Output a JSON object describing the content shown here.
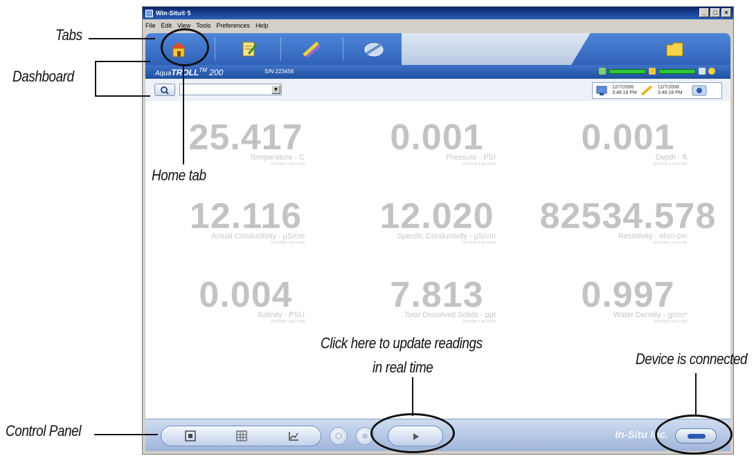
{
  "window": {
    "title": "Win-Situ® 5",
    "controls": [
      "_",
      "□",
      "×"
    ]
  },
  "menu": [
    "File",
    "Edit",
    "View",
    "Tools",
    "Preferences",
    "Help"
  ],
  "tabs": [
    {
      "icon": "home-icon"
    },
    {
      "icon": "sites-notepad-icon"
    },
    {
      "icon": "calibration-icon"
    },
    {
      "icon": "logging-icon"
    },
    {
      "icon": "folder-icon"
    }
  ],
  "dashboard": {
    "device_name_prefix": "Aqua",
    "device_name": "TROLL",
    "device_tm": "TM",
    "device_model": "200",
    "serial": "S/N 223456",
    "pc_time": {
      "date": "12/7/2006",
      "time": "3:48:18 PM"
    },
    "device_time": {
      "date": "12/7/2006",
      "time": "3:48:18 PM"
    }
  },
  "readings": [
    {
      "value": "25.417",
      "label": "Temperature - C",
      "timestamp": "12/7/2006 3:48:14 PM"
    },
    {
      "value": "0.001",
      "label": "Pressure - PSI",
      "timestamp": "12/7/2006 3:48:14 PM"
    },
    {
      "value": "0.001",
      "label": "Depth - ft",
      "timestamp": "12/7/2006 3:48:14 PM"
    },
    {
      "value": "12.116",
      "label": "Actual Conductivity - µS/cm",
      "timestamp": "12/7/2006 3:48:14 PM"
    },
    {
      "value": "12.020",
      "label": "Specific Conductivity - µS/cm",
      "timestamp": "12/7/2006 3:48:14 PM"
    },
    {
      "value": "82534.578",
      "label": "Resistivity - ohm-cm",
      "timestamp": "12/7/2006 3:48:14 PM"
    },
    {
      "value": "0.004",
      "label": "Salinity - PSU",
      "timestamp": "12/7/2006 3:48:14 PM"
    },
    {
      "value": "7.813",
      "label": "Total Dissolved Solids - ppt",
      "timestamp": "12/7/2006 3:48:14 PM"
    },
    {
      "value": "0.997",
      "label": "Water Density - g/cm³",
      "timestamp": "12/7/2006 3:48:14 PM"
    }
  ],
  "control_panel": {
    "brand": "In-Situ Inc.",
    "view_buttons": [
      "parameter-view-icon",
      "grid-view-icon",
      "graph-view-icon"
    ]
  },
  "callouts": {
    "tabs": "Tabs",
    "dashboard": "Dashboard",
    "home_tab": "Home tab",
    "update_line1": "Click here to update readings",
    "update_line2": "in real time",
    "connected": "Device is connected",
    "control_panel": "Control Panel"
  },
  "colors": {
    "accent_blue": "#2f62b8",
    "reading_gray": "#c3c3c3",
    "battery_green": "#2fc43a"
  }
}
